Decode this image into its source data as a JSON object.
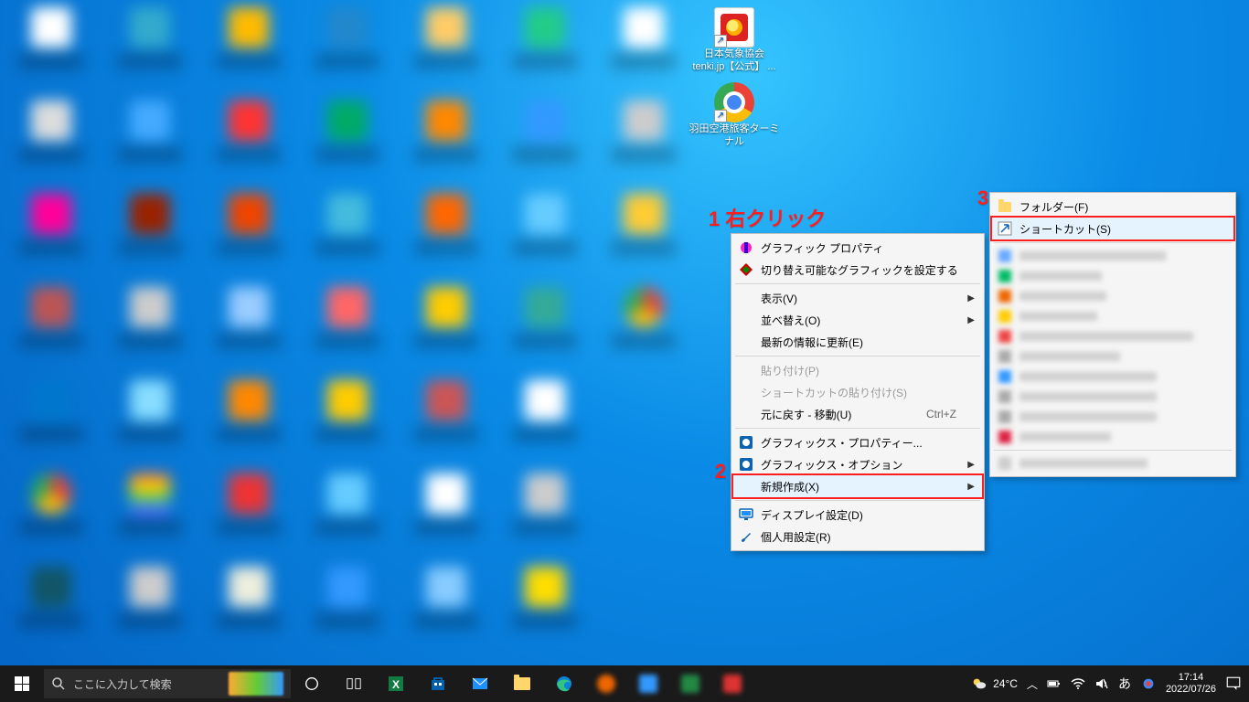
{
  "desktop_icons": [
    {
      "label_line1": "日本気象協会",
      "label_line2": "tenki.jp【公式】 ..."
    },
    {
      "label_line1": "羽田空港旅客ターミ",
      "label_line2": "ナル"
    }
  ],
  "annotations": {
    "a1": "1 右クリック",
    "a2": "2",
    "a3": "3"
  },
  "context_menu": {
    "graphics_properties": "グラフィック プロパティ",
    "switchable_graphics": "切り替え可能なグラフィックを設定する",
    "view": "表示(V)",
    "sort": "並べ替え(O)",
    "refresh": "最新の情報に更新(E)",
    "paste": "貼り付け(P)",
    "paste_shortcut": "ショートカットの貼り付け(S)",
    "undo": "元に戻す - 移動(U)",
    "undo_accel": "Ctrl+Z",
    "gfx_props2": "グラフィックス・プロパティー...",
    "gfx_options": "グラフィックス・オプション",
    "new": "新規作成(X)",
    "display_settings": "ディスプレイ設定(D)",
    "personalize": "個人用設定(R)"
  },
  "submenu": {
    "folder": "フォルダー(F)",
    "shortcut": "ショートカット(S)"
  },
  "taskbar": {
    "search_placeholder": "ここに入力して検索",
    "weather_temp": "24°C",
    "ime": "あ",
    "time": "17:14",
    "date": "2022/07/26"
  }
}
